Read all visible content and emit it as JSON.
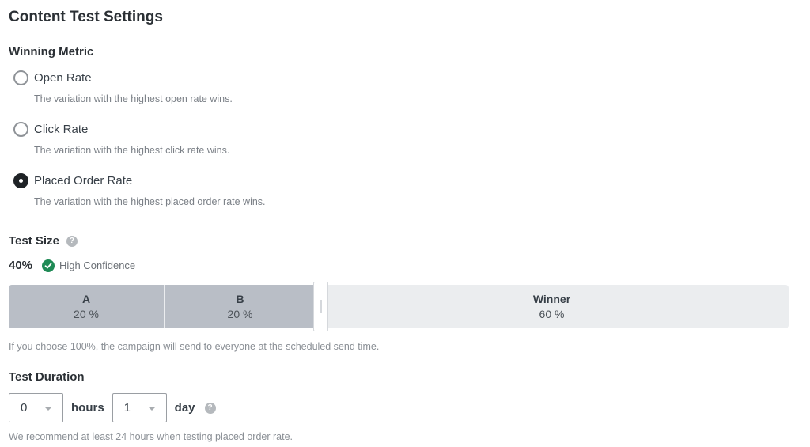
{
  "page": {
    "title": "Content Test Settings"
  },
  "winning_metric": {
    "title": "Winning Metric",
    "selected": "placed_order_rate",
    "options": [
      {
        "id": "open_rate",
        "label": "Open Rate",
        "description": "The variation with the highest open rate wins.",
        "checked": false
      },
      {
        "id": "click_rate",
        "label": "Click Rate",
        "description": "The variation with the highest click rate wins.",
        "checked": false
      },
      {
        "id": "placed_order_rate",
        "label": "Placed Order Rate",
        "description": "The variation with the highest placed order rate wins.",
        "checked": true
      }
    ]
  },
  "test_size": {
    "title": "Test Size",
    "help_icon": "question-circle-icon",
    "value": "40%",
    "confidence_icon": "check-circle-icon",
    "confidence_label": "High Confidence",
    "confidence_color": "#1f8a55",
    "segments": [
      {
        "label": "A",
        "percent": "20 %"
      },
      {
        "label": "B",
        "percent": "20 %"
      },
      {
        "label": "Winner",
        "percent": "60 %"
      }
    ],
    "hint": "If you choose 100%, the campaign will send to everyone at the scheduled send time."
  },
  "test_duration": {
    "title": "Test Duration",
    "hours_value": "0",
    "hours_label": "hours",
    "days_value": "1",
    "days_label": "day",
    "help_icon": "question-circle-icon",
    "hint": "We recommend at least 24 hours when testing placed order rate."
  }
}
